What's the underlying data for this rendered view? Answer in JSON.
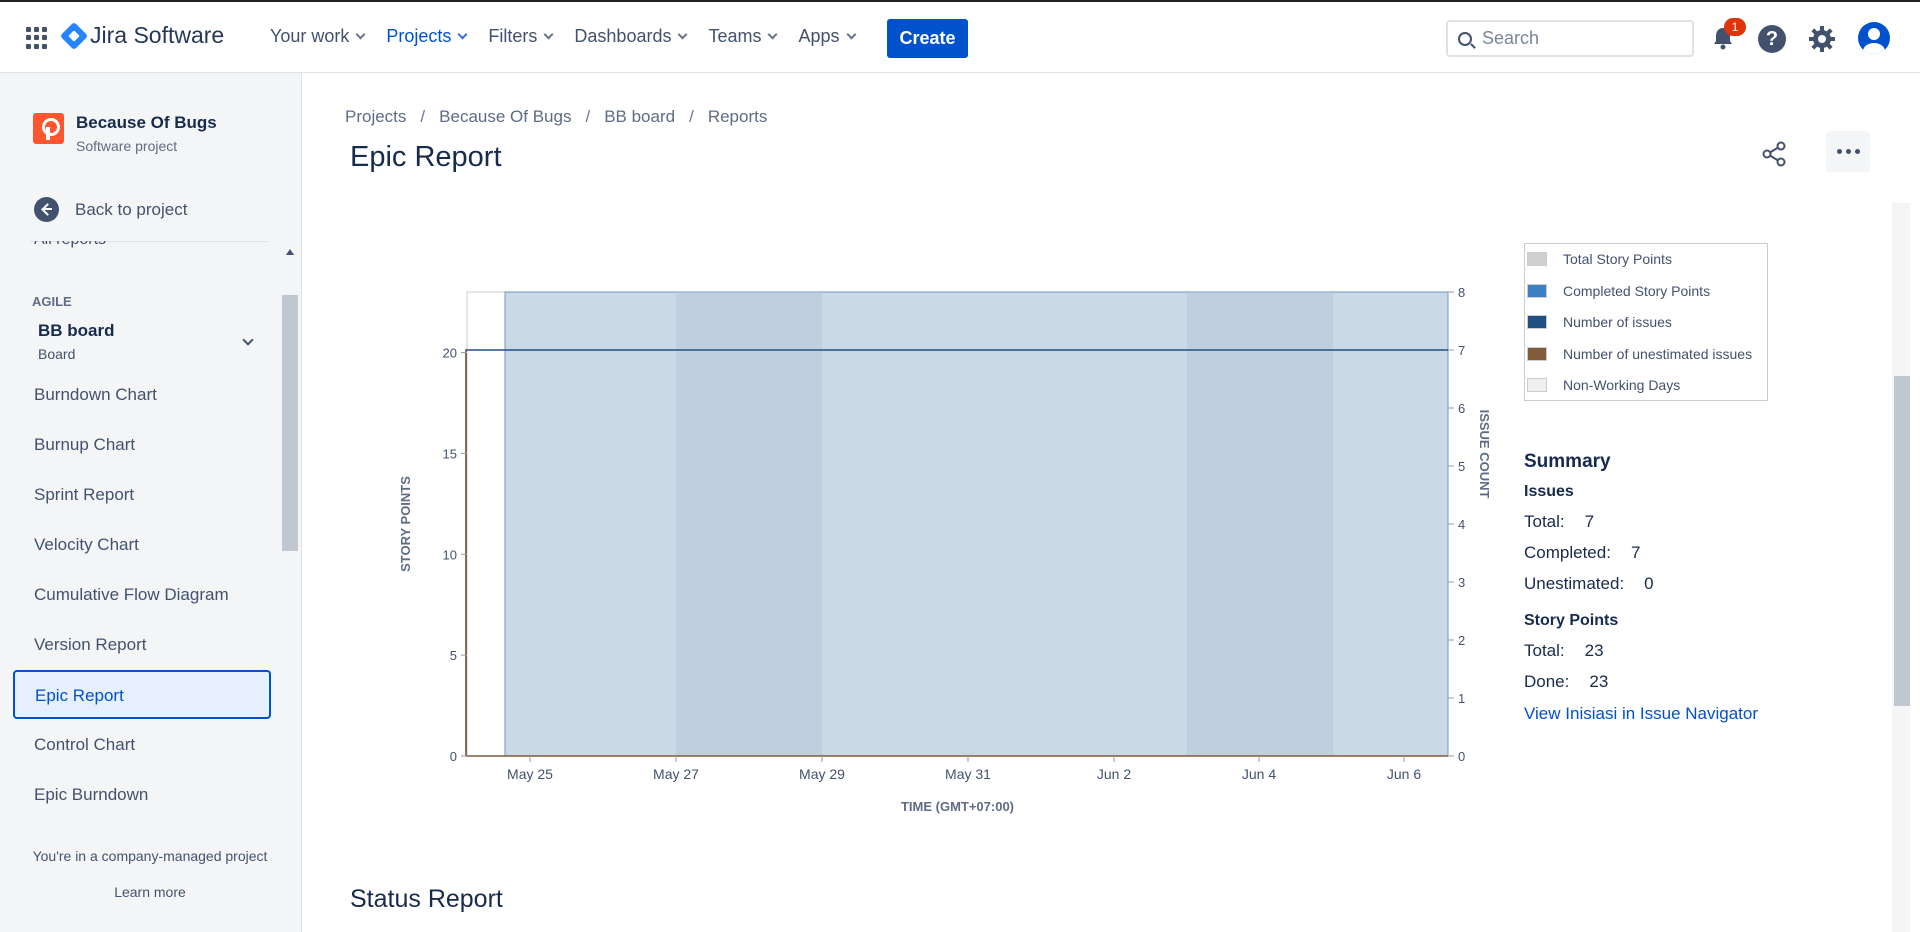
{
  "topbar": {
    "product": "Jira Software",
    "nav": [
      "Your work",
      "Projects",
      "Filters",
      "Dashboards",
      "Teams",
      "Apps"
    ],
    "create": "Create",
    "search_placeholder": "Search",
    "notification_count": "1"
  },
  "sidebar": {
    "project_name": "Because Of Bugs",
    "project_type": "Software project",
    "back": "Back to project",
    "all_reports": "All reports",
    "section": "AGILE",
    "board_name": "BB board",
    "board_sub": "Board",
    "items": [
      "Burndown Chart",
      "Burnup Chart",
      "Sprint Report",
      "Velocity Chart",
      "Cumulative Flow Diagram",
      "Version Report",
      "Epic Report",
      "Control Chart",
      "Epic Burndown"
    ],
    "active": "Epic Report",
    "company": "You're in a company-managed project",
    "learn": "Learn more"
  },
  "breadcrumb": [
    "Projects",
    "Because Of Bugs",
    "BB board",
    "Reports"
  ],
  "page_title": "Epic Report",
  "legend": [
    "Total Story Points",
    "Completed Story Points",
    "Number of issues",
    "Number of unestimated issues",
    "Non-Working Days"
  ],
  "legend_colors": [
    "#d0d0d0",
    "#3b7fc4",
    "#205081",
    "#815b3a",
    "#f0f0f0"
  ],
  "summary": {
    "title": "Summary",
    "issues_h": "Issues",
    "total_label": "Total:",
    "total": "7",
    "completed_label": "Completed:",
    "completed": "7",
    "unestimated_label": "Unestimated:",
    "unestimated": "0",
    "sp_h": "Story Points",
    "sp_total_label": "Total:",
    "sp_total": "23",
    "done_label": "Done:",
    "done": "23",
    "link": "View Inisiasi in Issue Navigator"
  },
  "status_title": "Status Report",
  "chart_data": {
    "type": "area",
    "title": "",
    "xlabel": "TIME (GMT+07:00)",
    "ylabel": "STORY POINTS",
    "y2label": "ISSUE COUNT",
    "x_ticks": [
      "May 25",
      "May 27",
      "May 29",
      "May 31",
      "Jun 2",
      "Jun 4",
      "Jun 6"
    ],
    "y_ticks": [
      0,
      5,
      10,
      15,
      20
    ],
    "y2_ticks": [
      0,
      1,
      2,
      3,
      4,
      5,
      6,
      7,
      8
    ],
    "ylim": [
      0,
      23
    ],
    "y2lim": [
      0,
      8
    ],
    "series": [
      {
        "name": "Total Story Points",
        "color": "#d0d0d0",
        "value": 23
      },
      {
        "name": "Completed Story Points",
        "color": "#3b7fc4",
        "value": 23
      },
      {
        "name": "Number of issues",
        "color": "#205081",
        "value": 7
      },
      {
        "name": "Number of unestimated issues",
        "color": "#815b3a",
        "value": 0
      }
    ],
    "non_working_days": [
      [
        "May 27",
        "May 29"
      ],
      [
        "Jun 3",
        "Jun 5"
      ]
    ],
    "grid": false
  }
}
